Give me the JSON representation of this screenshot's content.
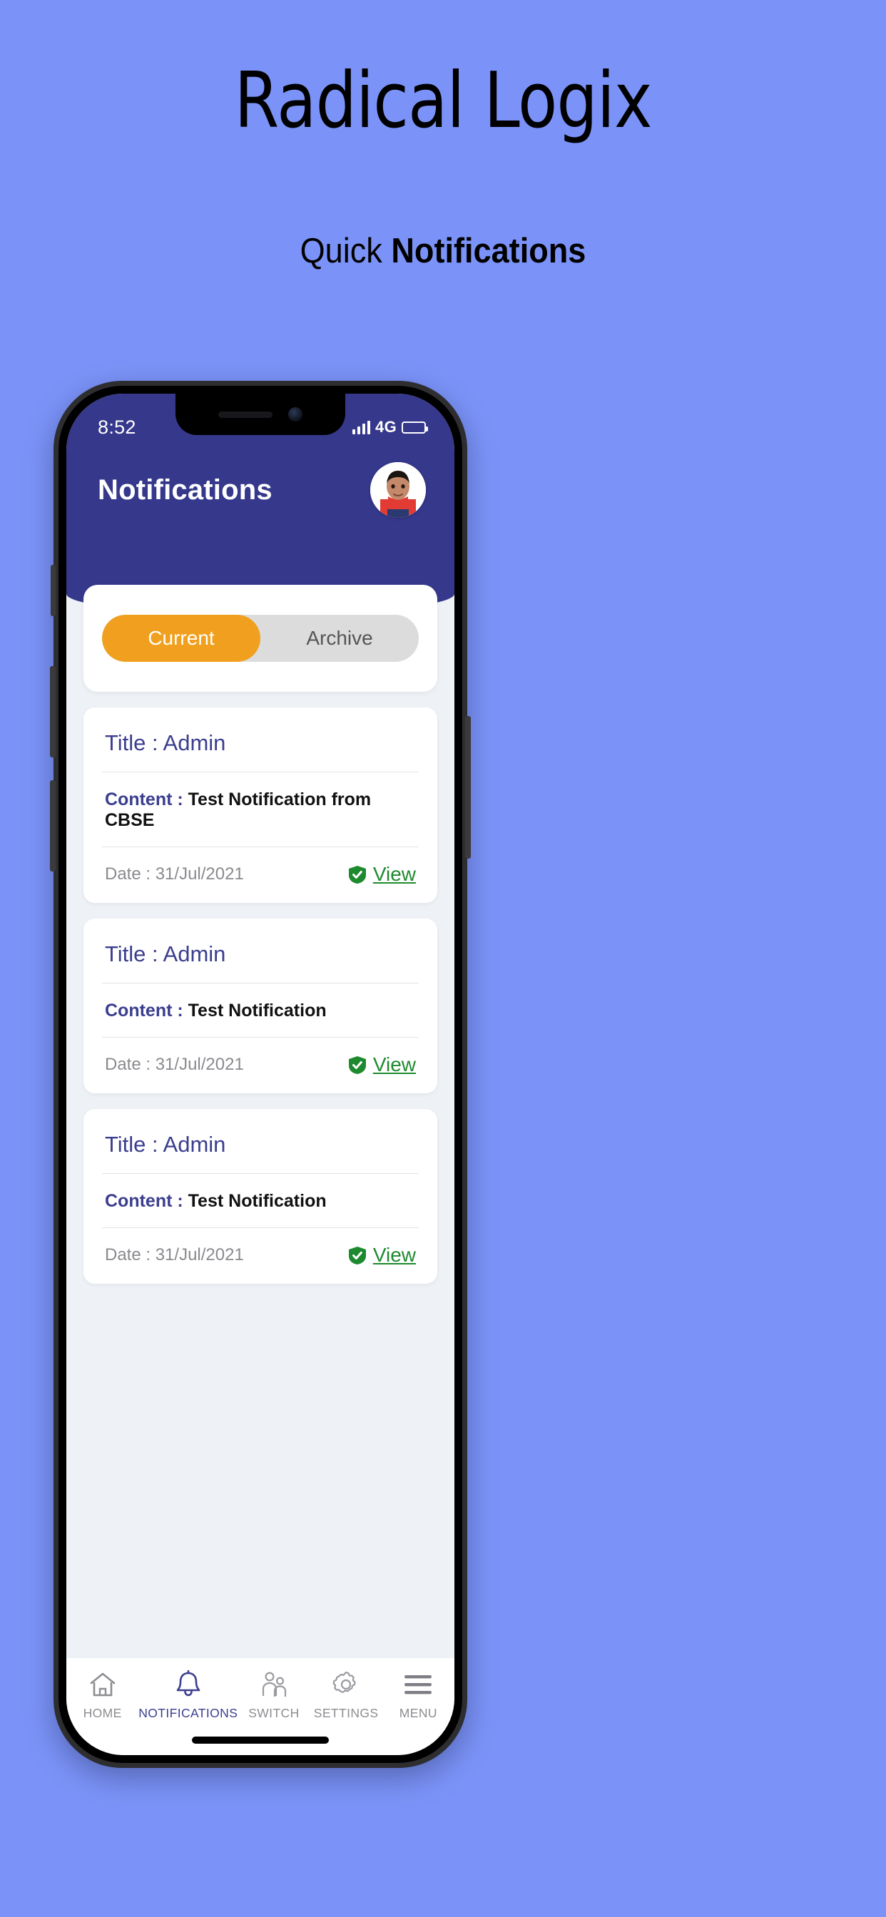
{
  "promo": {
    "title": "Radical Logix",
    "subtitle_regular": "Quick ",
    "subtitle_bold": "Notifications"
  },
  "colors": {
    "background": "#7B93F8",
    "header_navy": "#35388B",
    "accent_orange": "#F0A01E",
    "link_green": "#1E8A2F",
    "title_indigo": "#3B3E8E"
  },
  "status_bar": {
    "time": "8:52",
    "network": "4G",
    "signal_icon": "signal-bars-icon",
    "battery_icon": "battery-icon"
  },
  "header": {
    "title": "Notifications",
    "avatar_icon": "user-avatar"
  },
  "tabs": {
    "items": [
      {
        "label": "Current",
        "active": true
      },
      {
        "label": "Archive",
        "active": false
      }
    ]
  },
  "notifications": [
    {
      "title_label": "Title : ",
      "title_value": "Admin",
      "content_label": "Content : ",
      "content_value": "Test Notification from CBSE",
      "date_label": "Date : ",
      "date_value": "31/Jul/2021",
      "view_label": "View",
      "view_icon": "shield-check-icon"
    },
    {
      "title_label": "Title : ",
      "title_value": "Admin",
      "content_label": "Content : ",
      "content_value": "Test Notification",
      "date_label": "Date : ",
      "date_value": "31/Jul/2021",
      "view_label": "View",
      "view_icon": "shield-check-icon"
    },
    {
      "title_label": "Title : ",
      "title_value": "Admin",
      "content_label": "Content : ",
      "content_value": "Test Notification",
      "date_label": "Date : ",
      "date_value": "31/Jul/2021",
      "view_label": "View",
      "view_icon": "shield-check-icon"
    }
  ],
  "bottom_nav": [
    {
      "label": "HOME",
      "icon": "home-icon",
      "active": false
    },
    {
      "label": "NOTIFICATIONS",
      "icon": "bell-icon",
      "active": true
    },
    {
      "label": "SWITCH",
      "icon": "people-icon",
      "active": false
    },
    {
      "label": "SETTINGS",
      "icon": "gear-icon",
      "active": false
    },
    {
      "label": "MENU",
      "icon": "hamburger-icon",
      "active": false
    }
  ]
}
